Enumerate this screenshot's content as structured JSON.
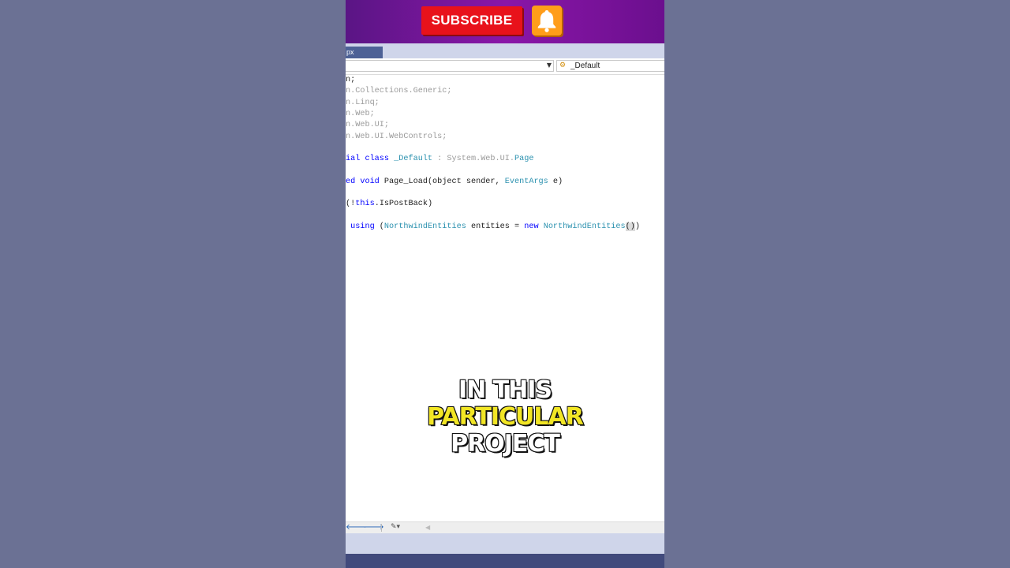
{
  "promo": {
    "subscribe_label": "SUBSCRIBE",
    "bell_icon": "bell-icon",
    "colors": {
      "subscribe": "#e8121b",
      "bell": "#ff9d1a",
      "banner": "#7a149a"
    }
  },
  "tab": {
    "label": "px"
  },
  "nav": {
    "class_selector": "_Default",
    "class_icon": "class-icon"
  },
  "code": {
    "lines": [
      [
        {
          "t": "n;"
        }
      ],
      [
        {
          "t": "n.Collections.Generic;",
          "c": "g"
        }
      ],
      [
        {
          "t": "n.Linq;",
          "c": "g"
        }
      ],
      [
        {
          "t": "n.Web;",
          "c": "g"
        }
      ],
      [
        {
          "t": "n.Web.UI;",
          "c": "g"
        }
      ],
      [
        {
          "t": "n.Web.UI.WebControls;",
          "c": "g"
        }
      ],
      [],
      [
        {
          "t": "ial class ",
          "c": "k"
        },
        {
          "t": "_Default",
          "c": "t"
        },
        {
          "t": " : System.Web.UI.",
          "c": "g"
        },
        {
          "t": "Page",
          "c": "t"
        }
      ],
      [],
      [
        {
          "t": "ed void ",
          "c": "k"
        },
        {
          "t": "Page_Load(object sender, "
        },
        {
          "t": "EventArgs",
          "c": "t"
        },
        {
          "t": " e)"
        }
      ],
      [],
      [
        {
          "t": "(!"
        },
        {
          "t": "this",
          "c": "k"
        },
        {
          "t": ".IsPostBack)"
        }
      ],
      [],
      [
        {
          "t": " using ",
          "c": "k"
        },
        {
          "t": "("
        },
        {
          "t": "NorthwindEntities",
          "c": "t"
        },
        {
          "t": " entities = "
        },
        {
          "t": "new ",
          "c": "k"
        },
        {
          "t": "NorthwindEntities",
          "c": "t"
        },
        {
          "t": "()",
          "c": "hl"
        },
        {
          "t": ")"
        }
      ]
    ]
  },
  "caption": {
    "line1": "IN THIS",
    "line2": "PARTICULAR",
    "line3": "PROJECT"
  },
  "statusbar": {
    "back_icon": "arrow-left-icon",
    "forward_icon": "arrow-right-icon",
    "tool_icon": "tool-dropdown-icon"
  }
}
